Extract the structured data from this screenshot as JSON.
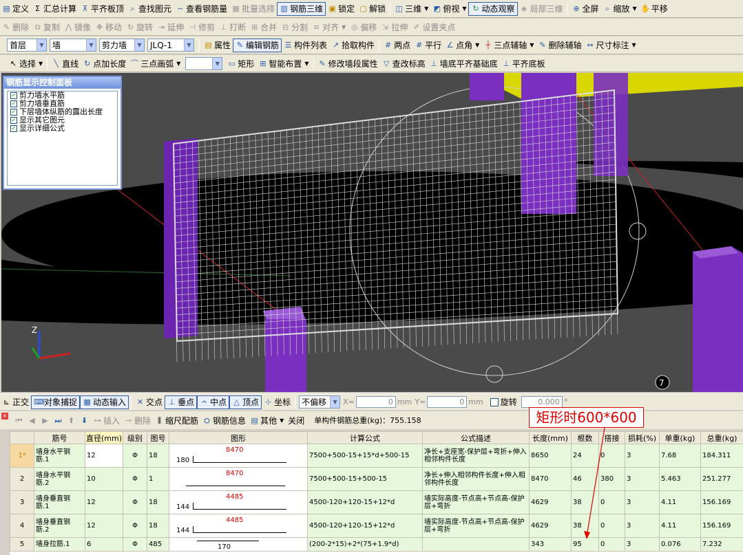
{
  "toolbar1": {
    "items": [
      "定义",
      "汇总计算",
      "平齐板顶",
      "查找图元",
      "查看钢筋量",
      "批量选择",
      "钢筋三维",
      "锁定",
      "解锁",
      "三维",
      "俯视",
      "动态观察",
      "局部三维",
      "全屏",
      "缩放",
      "平移"
    ]
  },
  "toolbar2": {
    "items": [
      "删除",
      "复制",
      "镜像",
      "移动",
      "旋转",
      "延伸",
      "修剪",
      "打断",
      "合并",
      "分割",
      "对齐",
      "偏移",
      "拉伸",
      "设置夹点"
    ]
  },
  "toolbar3": {
    "floor": "首层",
    "type": "墙",
    "subtype": "剪力墙",
    "name": "JLQ-1",
    "items": [
      "属性",
      "编辑钢筋",
      "构件列表",
      "拾取构件",
      "两点",
      "平行",
      "点角",
      "三点辅轴",
      "删除辅轴",
      "尺寸标注"
    ]
  },
  "toolbar4": {
    "items": [
      "选择",
      "直线",
      "点加长度",
      "三点画弧",
      "矩形",
      "智能布置",
      "修改墙段属性",
      "查改标高",
      "墙底平齐基础底",
      "平齐底板"
    ]
  },
  "panel": {
    "title": "钢筋显示控制面板",
    "options": [
      "剪力墙水平筋",
      "剪力墙垂直筋",
      "下层墙体纵筋的露出长度",
      "显示其它图元",
      "显示详细公式"
    ]
  },
  "viewport": {
    "axis_z": "Z",
    "point_label": "7"
  },
  "status": {
    "items": [
      "正交",
      "对象捕捉",
      "动态输入",
      "交点",
      "垂点",
      "中点",
      "顶点",
      "坐标"
    ],
    "offset": "不偏移",
    "x_label": "X=",
    "x_value": "0",
    "y_label": "Y=",
    "y_value": "0",
    "unit": "mm",
    "rotate": "旋转",
    "rotate_value": "0.000",
    "degree": "°"
  },
  "rebar_bar": {
    "items": [
      "插入",
      "删除",
      "缩尺配筋",
      "钢筋信息",
      "其他",
      "关闭"
    ],
    "total": "单构件钢筋总重(kg)：755.158"
  },
  "annotation": "矩形时600*600",
  "table": {
    "headers": [
      "",
      "筋号",
      "直径(mm)",
      "级别",
      "图号",
      "图形",
      "计算公式",
      "公式描述",
      "长度(mm)",
      "根数",
      "搭接",
      "损耗(%)",
      "单重(kg)",
      "总重(kg)"
    ],
    "rows": [
      {
        "no": "1*",
        "name": "墙身水平钢筋.1",
        "dia": "12",
        "grade": "Φ",
        "fig": "18",
        "shape_left": "180",
        "shape_val": "8470",
        "formula": "7500+500-15+15*d+500-15",
        "desc": "净长+支座宽-保护层+弯折+伸入相邻构件长度",
        "len": "8650",
        "count": "24",
        "lap": "0",
        "loss": "3",
        "unit": "7.68",
        "total": "184.311"
      },
      {
        "no": "2",
        "name": "墙身水平钢筋.2",
        "dia": "10",
        "grade": "Φ",
        "fig": "1",
        "shape_left": "",
        "shape_val": "8470",
        "formula": "7500+500-15+500-15",
        "desc": "净长+伸入相邻构件长度+伸入相邻构件长度",
        "len": "8470",
        "count": "46",
        "lap": "380",
        "loss": "3",
        "unit": "5.463",
        "total": "251.277"
      },
      {
        "no": "3",
        "name": "墙身垂直钢筋.1",
        "dia": "12",
        "grade": "Φ",
        "fig": "18",
        "shape_left": "144",
        "shape_val": "4485",
        "formula": "4500-120+120-15+12*d",
        "desc": "墙实际高度-节点高+节点高-保护层+弯折",
        "len": "4629",
        "count": "38",
        "lap": "0",
        "loss": "3",
        "unit": "4.11",
        "total": "156.169"
      },
      {
        "no": "4",
        "name": "墙身垂直钢筋.2",
        "dia": "12",
        "grade": "Φ",
        "fig": "18",
        "shape_left": "144",
        "shape_val": "4485",
        "formula": "4500-120+120-15+12*d",
        "desc": "墙实际高度-节点高+节点高-保护层+弯折",
        "len": "4629",
        "count": "38",
        "lap": "0",
        "loss": "3",
        "unit": "4.11",
        "total": "156.169"
      },
      {
        "no": "5",
        "name": "墙身拉筋.1",
        "dia": "6",
        "grade": "Φ",
        "fig": "485",
        "shape_left": "",
        "shape_val": "170",
        "formula": "(200-2*15)+2*(75+1.9*d)",
        "desc": "",
        "len": "343",
        "count": "95",
        "lap": "0",
        "loss": "3",
        "unit": "0.076",
        "total": "7.232"
      }
    ]
  },
  "colors": {
    "column": "#7a2fc0",
    "grid": "#c8c8c8",
    "annotation": "#e00000",
    "row_bg": "#e6f7dc"
  }
}
